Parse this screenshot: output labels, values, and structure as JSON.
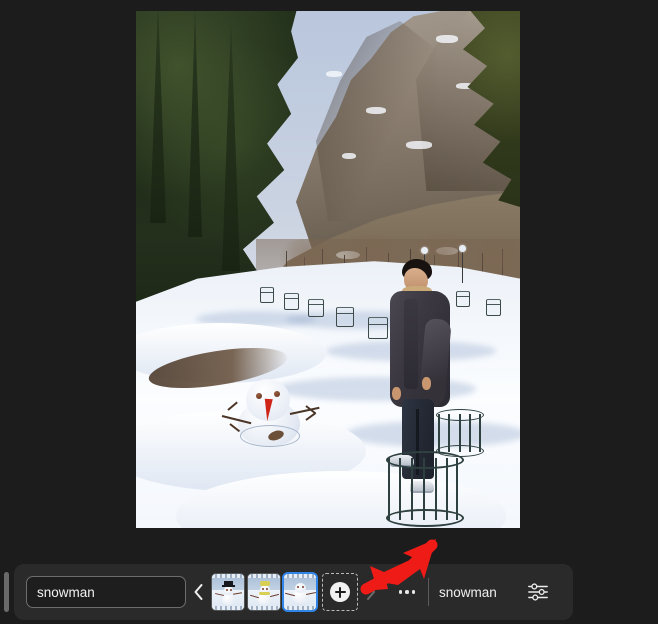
{
  "app": {
    "background_color": "#1c1c1c",
    "toolbar_color": "#2a2a2a",
    "accent_color": "#2f86e8",
    "annotation_color": "#ee1b16"
  },
  "viewer": {
    "name": "image-canvas",
    "image_description": "Winter mountain landscape photograph: a snow-covered park path with a small snowman in the foreground-left, a young man in a dark jacket and red shirt standing on a metal tree guard at right, bare deciduous trees with metal guards, dark evergreen pines on the left, and a rocky sunlit mountain ridge under a pale blue sky.",
    "subject_description": "snowman"
  },
  "toolbar": {
    "prompt_input": {
      "value": "snowman",
      "placeholder": "snowman"
    },
    "prev_label": "‹",
    "next_label": "›",
    "prev_enabled": true,
    "next_enabled": false,
    "thumbnails": [
      {
        "label": "snowman variant 1",
        "selected": false,
        "hat": "black-top-hat"
      },
      {
        "label": "snowman variant 2",
        "selected": false,
        "hat": "yellow-hat"
      },
      {
        "label": "snowman variant 3",
        "selected": true,
        "hat": "none"
      }
    ],
    "add_label": "+",
    "add_name": "add-image-button",
    "overflow_label": "•••",
    "layer_label": "snowman",
    "adjust_label": "Adjust settings"
  },
  "annotation": {
    "type": "arrow",
    "points_to": "add-image-button",
    "color": "#ee1b16"
  }
}
